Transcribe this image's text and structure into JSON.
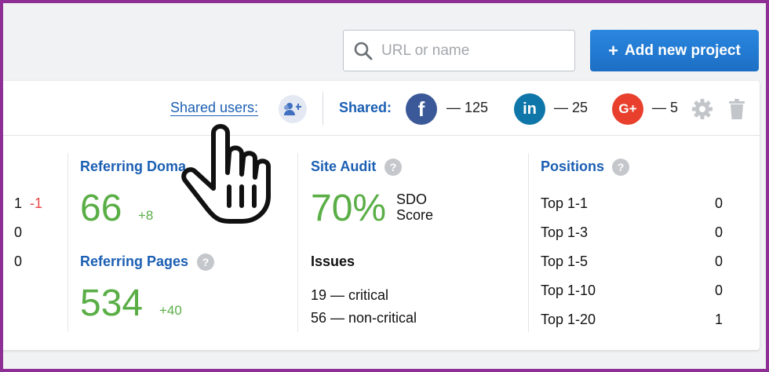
{
  "search": {
    "placeholder": "URL or name",
    "icon": "search-icon"
  },
  "add_project": {
    "plus": "+",
    "label": "Add new project"
  },
  "header": {
    "shared_users_label": "Shared users:",
    "shared_label": "Shared:",
    "facebook": {
      "glyph": "f",
      "count": "— 125"
    },
    "linkedin": {
      "glyph": "in",
      "count": "— 25"
    },
    "googleplus": {
      "glyph": "G+",
      "count": "— 5"
    }
  },
  "left_col": {
    "rows": [
      {
        "value": "1",
        "delta": "-1"
      },
      {
        "value": "0"
      },
      {
        "value": "0"
      }
    ]
  },
  "referring_domains": {
    "title": "Referring Doma",
    "value": "66",
    "delta": "+8"
  },
  "referring_pages": {
    "title": "Referring Pages",
    "value": "534",
    "delta": "+40"
  },
  "site_audit": {
    "title": "Site Audit",
    "value": "70%",
    "label_line1": "SDO",
    "label_line2": "Score",
    "issues_title": "Issues",
    "critical": "19 — critical",
    "noncritical": "56 — non-critical"
  },
  "positions": {
    "title": "Positions",
    "rows": [
      {
        "label": "Top 1-1",
        "value": "0"
      },
      {
        "label": "Top 1-3",
        "value": "0"
      },
      {
        "label": "Top 1-5",
        "value": "0"
      },
      {
        "label": "Top 1-10",
        "value": "0"
      },
      {
        "label": "Top 1-20",
        "value": "1"
      }
    ]
  },
  "help_glyph": "?",
  "colors": {
    "accent": "#1b5fb3",
    "positive": "#5aae46",
    "negative": "#ee4444",
    "button": "#2a87e0",
    "frame": "#8e2f95"
  }
}
